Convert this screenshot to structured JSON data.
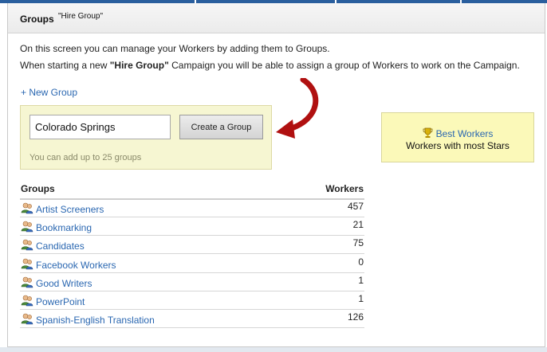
{
  "header": {
    "title": "Groups",
    "subtitle": "\"Hire Group\""
  },
  "intro": {
    "line1": "On this screen you can manage your Workers by adding them to Groups.",
    "line2_before": "When starting a new ",
    "line2_bold": "\"Hire Group\"",
    "line2_after": " Campaign you will be able to assign a group of Workers to work on the Campaign."
  },
  "new_group_link": "+ New Group",
  "create_form": {
    "input_value": "Colorado Springs",
    "button_label": "Create a Group",
    "hint": "You can add up to 25 groups"
  },
  "best_workers": {
    "icon": "trophy-icon",
    "link_label": "Best Workers",
    "description": "Workers with most Stars"
  },
  "table": {
    "headers": {
      "groups": "Groups",
      "workers": "Workers"
    },
    "row_icon": "users-group-icon",
    "rows": [
      {
        "name": "Artist Screeners",
        "workers": "457"
      },
      {
        "name": "Bookmarking",
        "workers": "21"
      },
      {
        "name": "Candidates",
        "workers": "75"
      },
      {
        "name": "Facebook Workers",
        "workers": "0"
      },
      {
        "name": "Good Writers",
        "workers": "1"
      },
      {
        "name": "PowerPoint",
        "workers": "1"
      },
      {
        "name": "Spanish-English Translation",
        "workers": "126"
      }
    ]
  },
  "colors": {
    "link": "#2a67b1",
    "form_box": "#f6f6d2",
    "best_box": "#fbf9b9",
    "arrow": "#b01010",
    "top_bar": "#2a5f9e"
  }
}
